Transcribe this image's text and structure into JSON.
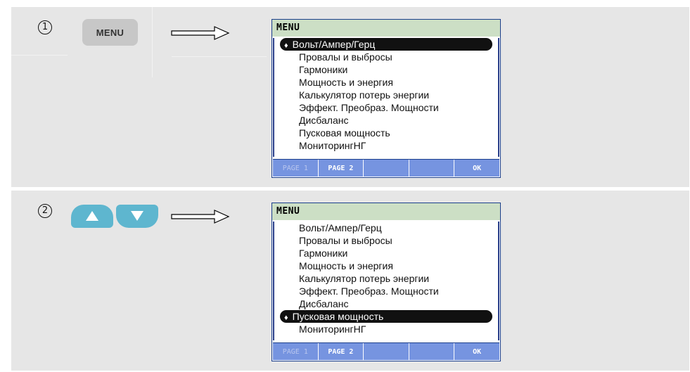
{
  "steps": [
    {
      "number": "1",
      "key_label": "MENU",
      "screen": {
        "title": "MENU",
        "items": [
          "Вольт/Ампер/Герц",
          "Провалы и выбросы",
          "Гармоники",
          "Мощность и энергия",
          "Калькулятор потерь энергии",
          "Эффект. Преобраз. Мощности",
          "Дисбаланс",
          "Пусковая мощность",
          "МониторингНГ"
        ],
        "selected_index": 0,
        "softkeys": [
          "PAGE 1",
          "PAGE 2",
          "",
          "",
          "OK"
        ]
      }
    },
    {
      "number": "2",
      "keys": [
        "up-arrow-icon",
        "down-arrow-icon"
      ],
      "screen": {
        "title": "MENU",
        "items": [
          "Вольт/Ампер/Герц",
          "Провалы и выбросы",
          "Гармоники",
          "Мощность и энергия",
          "Калькулятор потерь энергии",
          "Эффект. Преобраз. Мощности",
          "Дисбаланс",
          "Пусковая мощность",
          "МониторингНГ"
        ],
        "selected_index": 7,
        "softkeys": [
          "PAGE 1",
          "PAGE 2",
          "",
          "",
          "OK"
        ]
      }
    }
  ],
  "colors": {
    "panel_bg": "#e6e6e6",
    "screen_title_bg": "#ccdfc5",
    "softkey_bg": "#7694e0",
    "nav_key": "#5eb6cf",
    "menu_key": "#c7c7c7"
  }
}
